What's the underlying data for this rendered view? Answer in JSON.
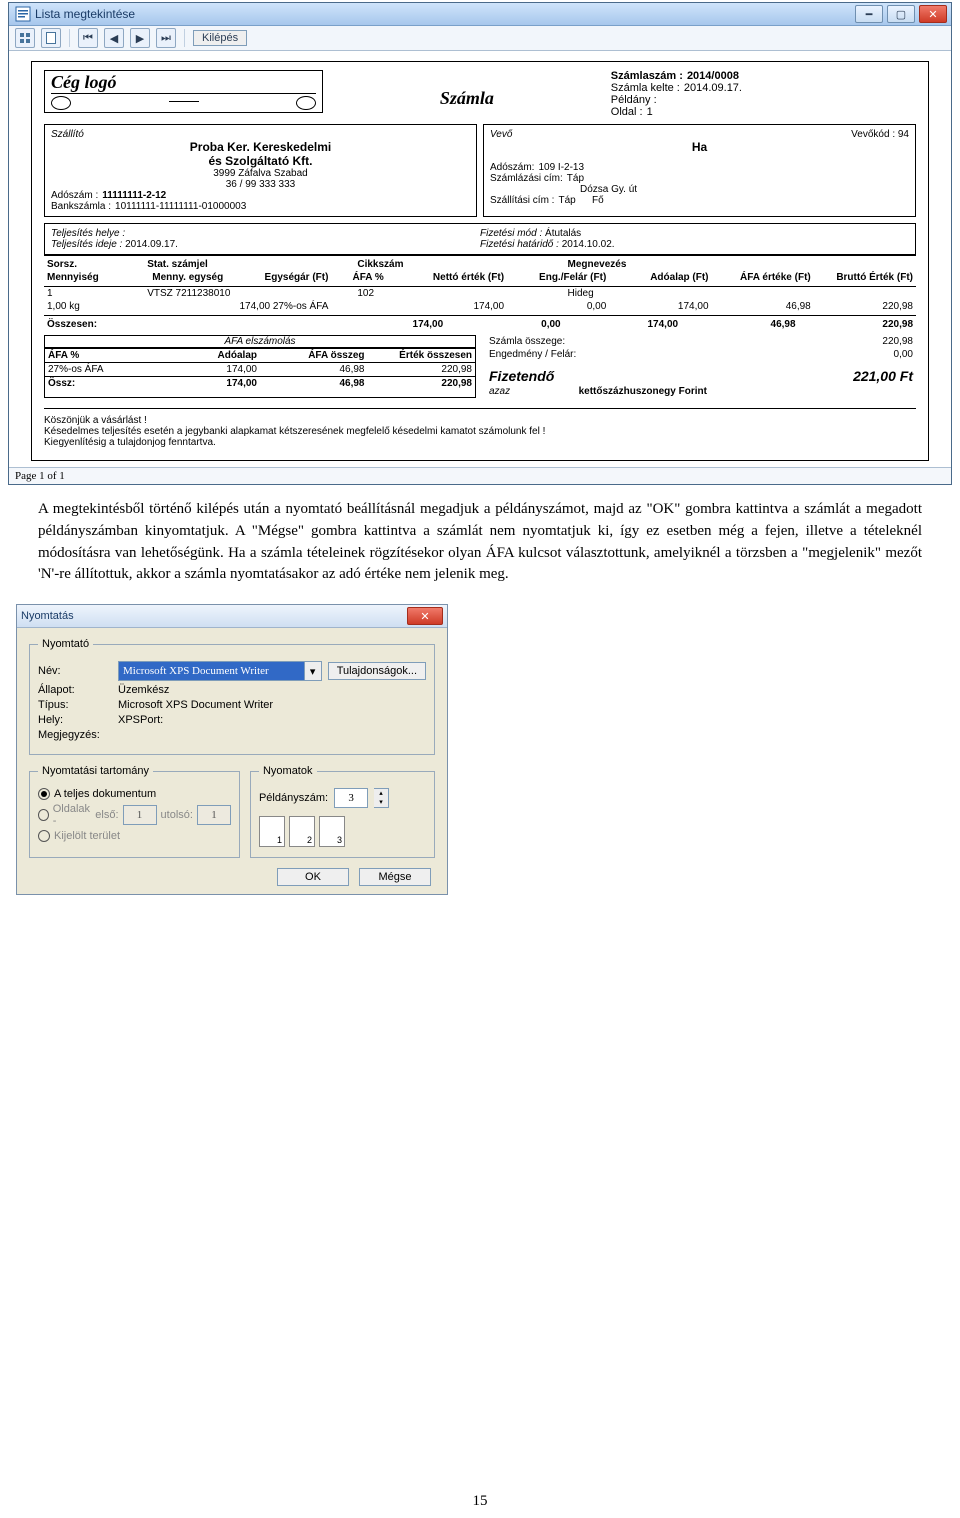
{
  "window": {
    "title": "Lista megtekintése",
    "exit_label": "Kilépés",
    "status": "Page 1 of 1"
  },
  "invoice": {
    "logo": "Cég logó",
    "doc_title": "Számla",
    "meta": {
      "number_label": "Számlaszám :",
      "number": "2014/0008",
      "date_label": "Számla kelte :",
      "date": "2014.09.17.",
      "copy_label": "Példány :",
      "copy": "",
      "page_label": "Oldal   :",
      "page": "1"
    },
    "supplier": {
      "heading": "Szállító",
      "name1": "Proba Ker. Kereskedelmi",
      "name2": "és Szolgáltató Kft.",
      "addr": "3999 Záfalva Szabad",
      "tel": "36 / 99 333 333",
      "tax_label": "Adószám   :",
      "tax": "11111111-2-12",
      "bank_label": "Bankszámla :",
      "bank": "10111111-11111111-01000003"
    },
    "buyer": {
      "heading": "Vevő",
      "code_label": "Vevőkód :",
      "code": "94",
      "name": "Ha",
      "tax_label": "Adószám:",
      "tax": "109        I-2-13",
      "bill_label": "Számlázási cím:",
      "bill1": "Táp",
      "bill2": "Dózsa Gy. út",
      "ship_label": "Szállítási cím  :",
      "ship1": "Táp",
      "ship2": "Fő"
    },
    "terms": {
      "place_label": "Teljesítés helye :",
      "time_label": "Teljesítés ideje :",
      "time": "2014.09.17.",
      "paymode_label": "Fizetési mód :",
      "paymode": "Átutalás",
      "due_label": "Fizetési határidő :",
      "due": "2014.10.02."
    },
    "thead": {
      "sorsz": "Sorsz.",
      "stat": "Stat. számjel",
      "cikk": "Cikkszám",
      "megn": "Megnevezés",
      "menny": "Mennyiség",
      "me": "Menny. egység",
      "egysegar": "Egységár (Ft)",
      "afa": "ÁFA %",
      "netto": "Nettó érték (Ft)",
      "eng": "Eng./Felár (Ft)",
      "adoalap": "Adóalap (Ft)",
      "afae": "ÁFA értéke (Ft)",
      "brutto": "Bruttó Érték (Ft)"
    },
    "line": {
      "sorsz": "1",
      "stat": "VTSZ 7211238010",
      "cikk": "102",
      "megn": "Hideg",
      "menny": "1,00",
      "me": "kg",
      "egysegar": "174,00",
      "afa_type": "27%-os ÁFA",
      "netto": "174,00",
      "eng": "0,00",
      "adoalap": "174,00",
      "afae": "46,98",
      "brutto": "220,98"
    },
    "totals": {
      "osszesen_label": "Összesen:",
      "netto": "174,00",
      "eng": "0,00",
      "adoalap": "174,00",
      "afae": "46,98",
      "brutto": "220,98",
      "sum_label": "Számla összege:",
      "sum": "220,98",
      "disc_label": "Engedmény / Felár:",
      "disc": "0,00",
      "pay_label": "Fizetendő",
      "pay": "221,00 Ft",
      "words_prefix": "azaz",
      "words": "kettőszázhuszonegy Forint"
    },
    "afa_table": {
      "title": "ÁFA elszámolás",
      "h1": "ÁFA %",
      "h2": "Adóalap",
      "h3": "ÁFA összeg",
      "h4": "Érték összesen",
      "row_label": "27%-os ÁFA",
      "a": "174,00",
      "b": "46,98",
      "c": "220,98",
      "sum_label": "Össz:",
      "sa": "174,00",
      "sb": "46,98",
      "sc": "220,98"
    },
    "footer": {
      "l1": "Köszönjük a vásárlást !",
      "l2": "Késedelmes teljesítés esetén  a jegybanki alapkamat kétszeresének megfelelő késedelmi kamatot számolunk fel !",
      "l3": "Kiegyenlítésig a tulajdonjog fenntartva."
    }
  },
  "paragraph": "A megtekintésből történő kilépés után a nyomtató beállításnál megadjuk a példányszámot, majd az \"OK\" gombra kattintva a számlát a megadott példányszámban kinyomtatjuk. A \"Mégse\" gombra kattintva a számlát nem nyomtatjuk ki, így ez esetben még a fejen, illetve a tételeknél módosításra van lehetőségünk. Ha a számla tételeinek rögzítésekor olyan ÁFA kulcsot választottunk, amelyiknél a törzsben a \"megjelenik\" mezőt 'N'-re állítottuk, akkor a számla nyomtatásakor az adó értéke nem jelenik meg.",
  "print": {
    "title": "Nyomtatás",
    "grp_printer": "Nyomtató",
    "name_label": "Név:",
    "name": "Microsoft XPS Document Writer",
    "props": "Tulajdonságok...",
    "state_label": "Állapot:",
    "state": "Üzemkész",
    "type_label": "Típus:",
    "type": "Microsoft XPS Document Writer",
    "where_label": "Hely:",
    "where": "XPSPort:",
    "comment_label": "Megjegyzés:",
    "grp_range": "Nyomtatási tartomány",
    "r_all": "A teljes dokumentum",
    "r_pages": "Oldalak -",
    "from": "első:",
    "from_v": "1",
    "to": "utolsó:",
    "to_v": "1",
    "r_sel": "Kijelölt terület",
    "grp_copies": "Nyomatok",
    "copies_label": "Példányszám:",
    "copies": "3",
    "collate": [
      "1",
      "2",
      "3"
    ],
    "ok": "OK",
    "cancel": "Mégse"
  },
  "page_number": "15"
}
